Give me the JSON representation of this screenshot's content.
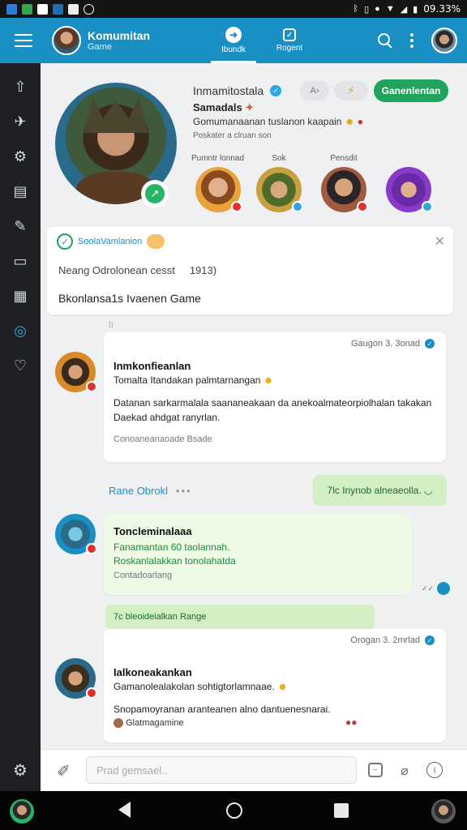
{
  "status_bar": {
    "time": "09.33%"
  },
  "app_bar": {
    "title": "Komumitan",
    "subtitle": "Game",
    "tabs": [
      {
        "label": "Ibundk"
      },
      {
        "label": "Rogent"
      }
    ]
  },
  "profile": {
    "name": "Inmamitostala",
    "subname": "Samadals",
    "description": "Gomumanaanan tuslanon kaapain",
    "meta": "Poskater a clruan son",
    "follow_label": "Ganenlentan",
    "friends": [
      {
        "label": "Pumntr lonnad",
        "color": "#e8a23a"
      },
      {
        "label": "Sok",
        "color": "#4f8a3a"
      },
      {
        "label": "Pensdit",
        "color": "#a05a40"
      },
      {
        "label": "",
        "color": "#8a3ac8"
      }
    ]
  },
  "notification": {
    "title": "SoolaVamlanion",
    "line1": "Neang Odrolonean cesst",
    "line1_num": "1913)",
    "line2": "Bkonlansa1s Ivaenen Game"
  },
  "posts": [
    {
      "time": "Gaugon 3. 3onad",
      "title": "Inmkonfieanlan",
      "subtitle": "Tomalta Itandakan palmtarnangan",
      "body1": "Datanan sarkarmalala saananeakaan da anekoalmateorpiolhalan takakan",
      "body2": "Daekad ahdgat ranyrlan.",
      "footer": "Conoaneanaoade Bsade"
    },
    {
      "title": "Toncleminalaaa",
      "line1": "Fanamantan 60 taolannah.",
      "line2": "Roskanlalakkan tonolahatda",
      "footer": "Contadoarlang"
    },
    {
      "time": "Orogan 3. 2mrlad",
      "title": "Ialkoneakankan",
      "subtitle": "Gamanolealakolan sohtigtorlamnaae.",
      "body": "Snopamoyranan aranteanen alno dantuenesnarai.",
      "footer": "Glatmagamine"
    }
  ],
  "reply": {
    "link_label": "Rane Obrokl",
    "bubble_text": "7lc Inynob alneaeolla."
  },
  "strip": {
    "text": "7c  bleoideialkan Range"
  },
  "composer": {
    "placeholder": "Prad gemsael.."
  }
}
